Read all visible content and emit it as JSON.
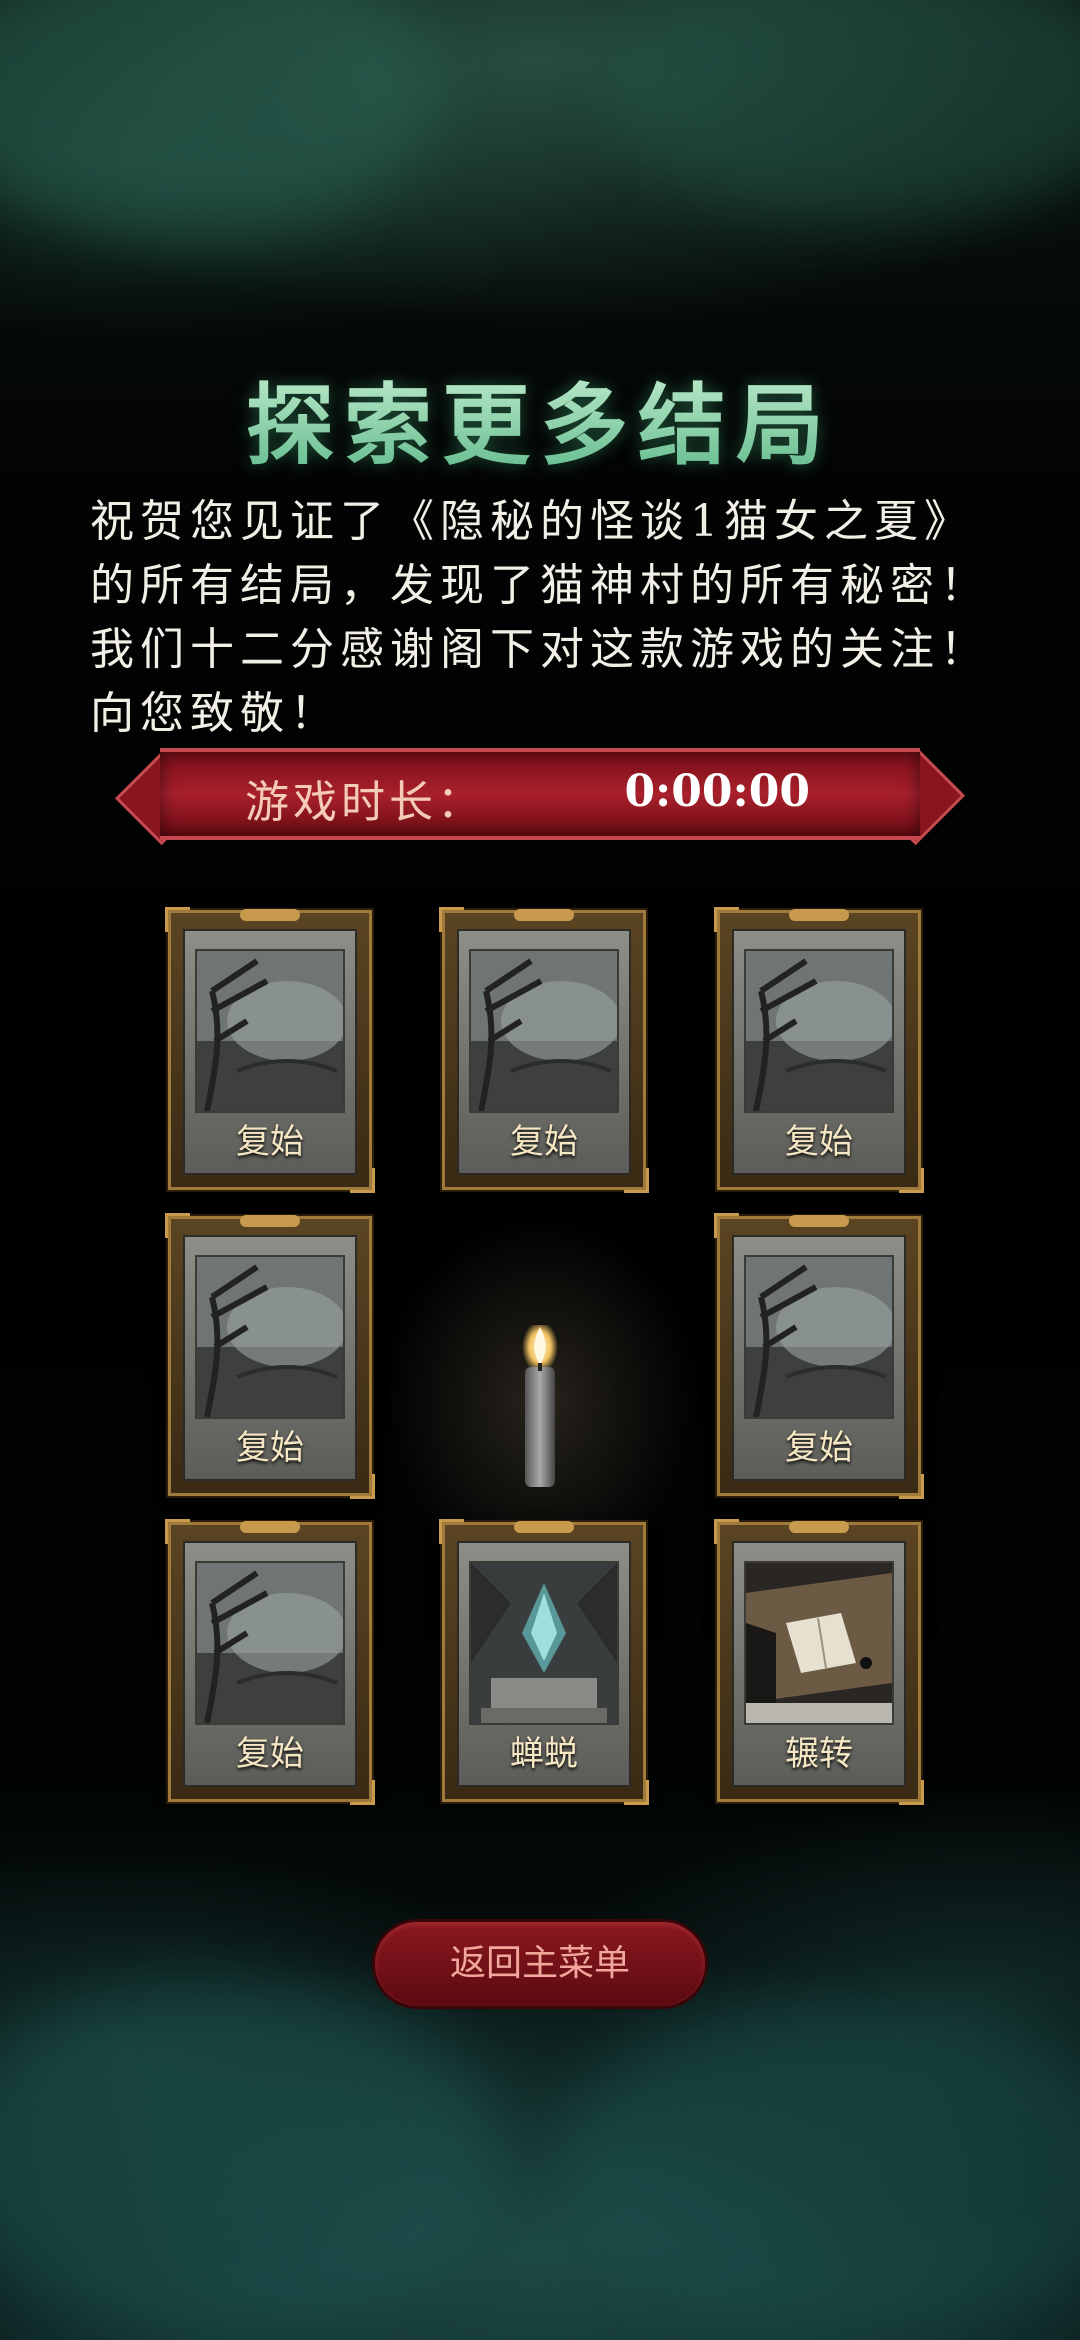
{
  "title": "探索更多结局",
  "message": "祝贺您见证了《隐秘的怪谈1猫女之夏》的所有结局，发现了猫神村的所有秘密！我们十二分感谢阁下对这款游戏的关注！向您致敬！",
  "playtime": {
    "label": "游戏时长：",
    "value": "0:00:00"
  },
  "endings": [
    {
      "label": "复始",
      "art": "forest-tree"
    },
    {
      "label": "复始",
      "art": "forest-tree"
    },
    {
      "label": "复始",
      "art": "forest-tree"
    },
    {
      "label": "复始",
      "art": "forest-tree"
    },
    {
      "label": "复始",
      "art": "forest-tree"
    },
    {
      "label": "复始",
      "art": "forest-tree"
    },
    {
      "label": "蝉蜕",
      "art": "cicada-shell"
    },
    {
      "label": "辗转",
      "art": "desk-book"
    }
  ],
  "back_button": {
    "label": "返回主菜单"
  },
  "colors": {
    "title": "#8fd4a8",
    "banner": "#a8202c",
    "card_frame": "#a07a3a",
    "button": "#8c1820"
  }
}
